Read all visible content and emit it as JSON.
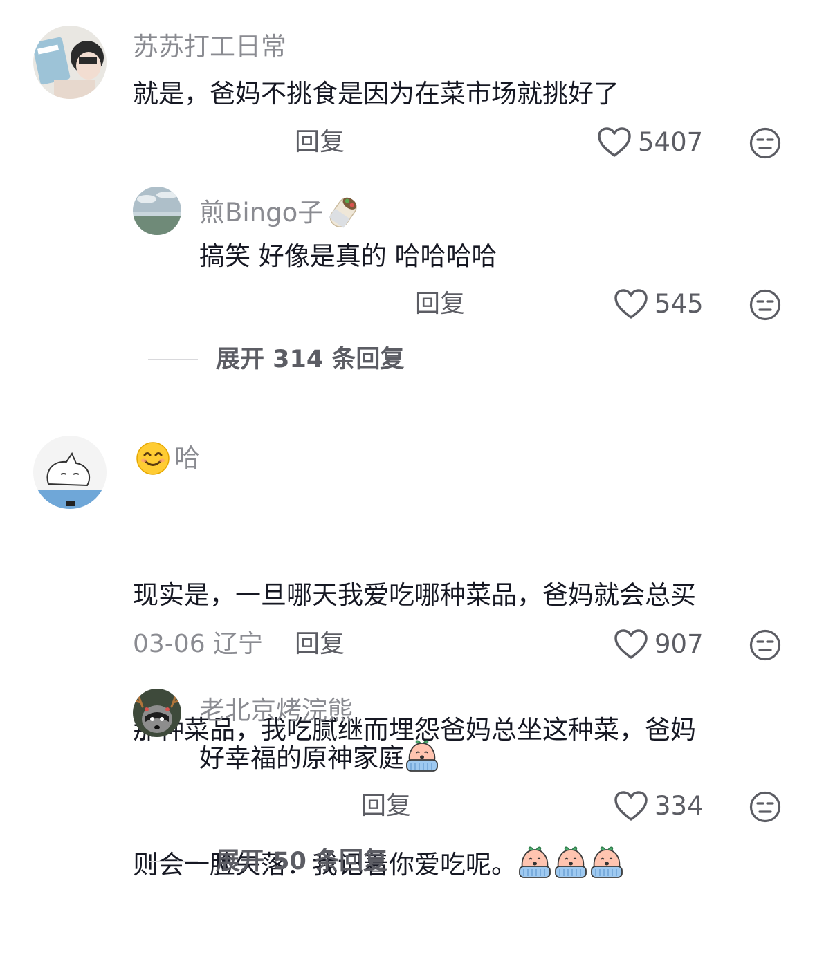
{
  "comments": [
    {
      "username": "苏苏打工日常",
      "text": "就是，爸妈不挑食是因为在菜市场就挑好了",
      "reply_label": "回复",
      "likes": "5407",
      "replies": [
        {
          "username": "煎Bingo子",
          "text": "搞笑 好像是真的 哈哈哈哈",
          "reply_label": "回复",
          "likes": "545"
        }
      ],
      "expand_label": "展开 314 条回复"
    },
    {
      "username": "哈",
      "text_lines": [
        "现实是，一旦哪天我爱吃哪种菜品，爸妈就会总买",
        "那种菜品，我吃腻继而埋怨爸妈总坐这种菜，爸妈",
        "则会一脸失落：我记着你爱吃呢。"
      ],
      "meta": "03-06 辽宁",
      "reply_label": "回复",
      "likes": "907",
      "replies": [
        {
          "username": "老北京烤浣熊",
          "text": "好幸福的原神家庭",
          "reply_label": "回复",
          "likes": "334"
        }
      ],
      "expand_label": "展开 50 条回复"
    }
  ],
  "icons": {
    "like": "heart-outline-icon",
    "dislike": "meh-face-icon",
    "emoji_burrito": "burrito-icon",
    "emoji_smile": "smiling-face-icon",
    "emoji_crying_peach": "crying-peach-sticker"
  },
  "colors": {
    "username": "#8a8b91",
    "text": "#161823",
    "action": "#5c5d64",
    "divider": "#d9d9dc",
    "emoji_yellow": "#ffcc33"
  }
}
